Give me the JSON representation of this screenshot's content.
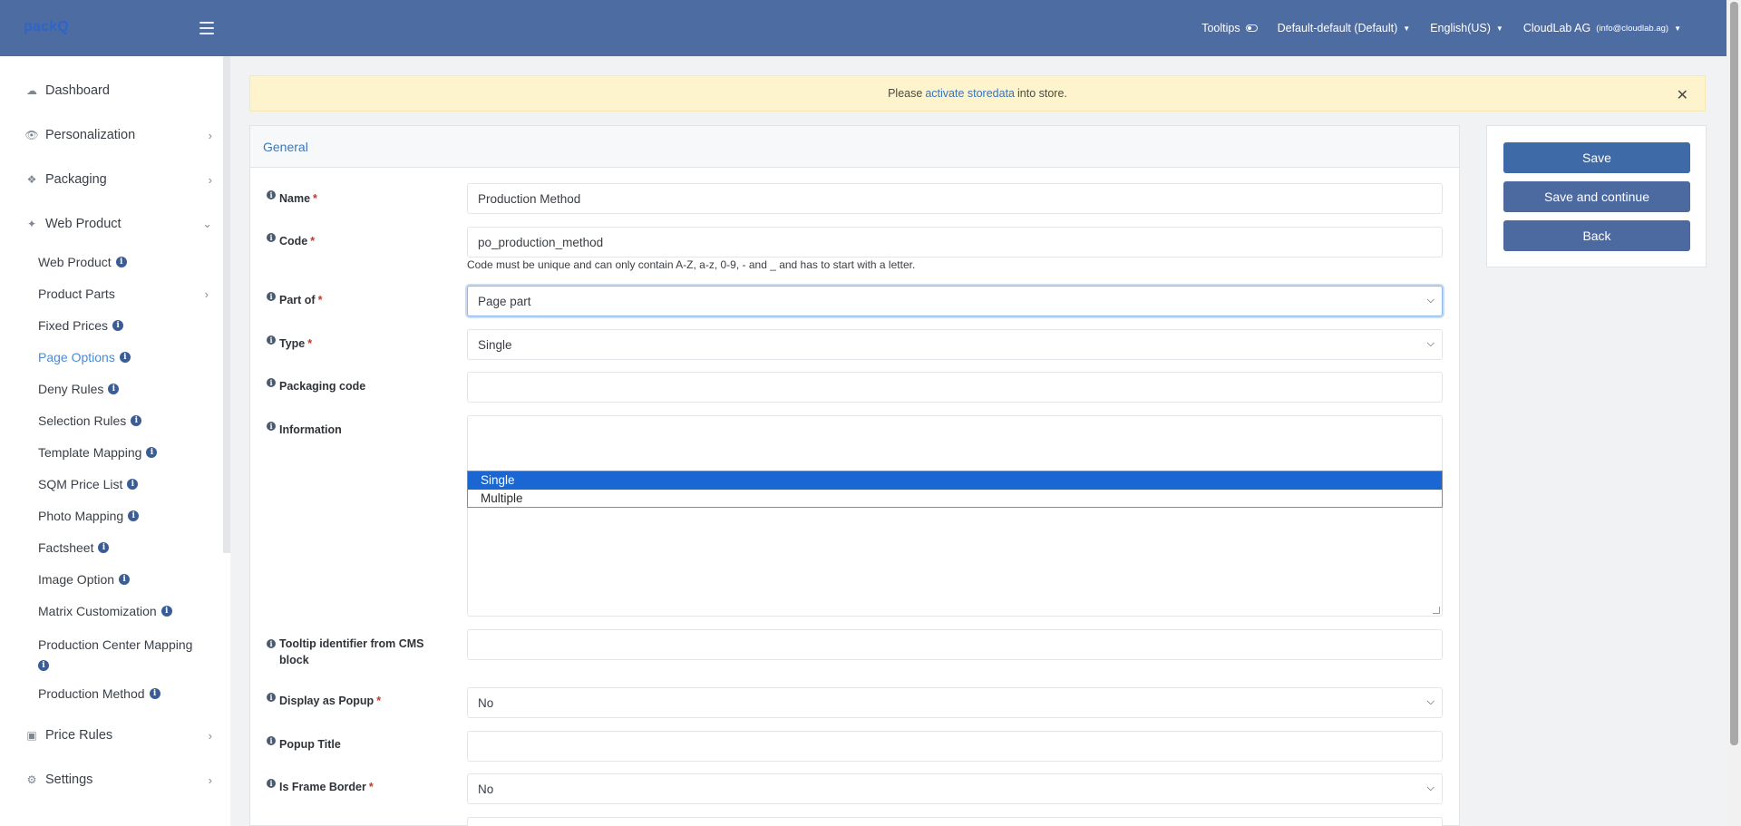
{
  "header": {
    "logo": "packQ",
    "tooltips_label": "Tooltips",
    "store_view": "Default-default (Default)",
    "language": "English(US)",
    "company": "CloudLab AG",
    "email": "(info@cloudlab.ag)"
  },
  "sidebar": {
    "dashboard": "Dashboard",
    "personalization": "Personalization",
    "packaging": "Packaging",
    "web_product": "Web Product",
    "sub_items": [
      "Web Product",
      "Product Parts",
      "Fixed Prices",
      "Page Options",
      "Deny Rules",
      "Selection Rules",
      "Template Mapping",
      "SQM Price List",
      "Photo Mapping",
      "Factsheet",
      "Image Option",
      "Matrix Customization",
      "Production Center Mapping",
      "Production Method"
    ],
    "price_rules": "Price Rules",
    "settings": "Settings"
  },
  "alert": {
    "prefix": "Please",
    "link": "activate storedata",
    "suffix": "into store."
  },
  "form": {
    "section_title": "General",
    "name_label": "Name",
    "name_value": "Production Method",
    "code_label": "Code",
    "code_value": "po_production_method",
    "code_hint": "Code must be unique and can only contain A-Z, a-z, 0-9, - and _ and has to start with a letter.",
    "part_of_label": "Part of",
    "part_of_value": "Page part",
    "type_label": "Type",
    "type_value": "Single",
    "type_options": [
      "Single",
      "Multiple"
    ],
    "packaging_code_label": "Packaging code",
    "information_label": "Information",
    "tooltip_label": "Tooltip identifier from CMS block",
    "popup_label": "Display as Popup",
    "popup_value": "No",
    "popup_title_label": "Popup Title",
    "frame_border_label": "Is Frame Border",
    "frame_border_value": "No",
    "required_mark": "*"
  },
  "actions": {
    "save": "Save",
    "save_continue": "Save and continue",
    "back": "Back"
  }
}
